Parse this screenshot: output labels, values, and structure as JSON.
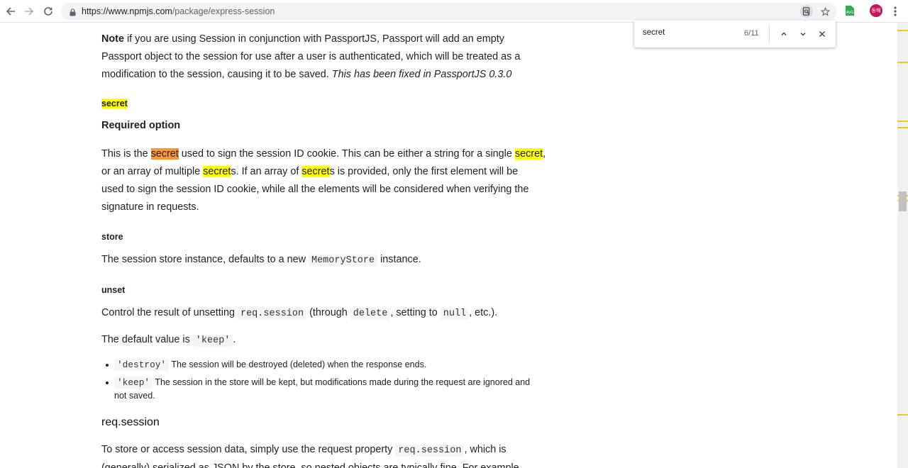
{
  "browser": {
    "url_host": "https://www.npmjs.com",
    "url_path": "/package/express-session",
    "avatar_text": "동해",
    "icons": [
      "back-icon",
      "forward-icon",
      "reload-icon",
      "lock-icon",
      "find-in-page-icon",
      "star-icon",
      "extension-icon",
      "menu-icon"
    ],
    "accent_color": "#1a73e8"
  },
  "find_bar": {
    "query": "secret",
    "count": "6/11"
  },
  "content": {
    "note_bold": "Note",
    "note_text": " if you are using Session in conjunction with PassportJS, Passport will add an empty Passport object to the session for use after a user is authenticated, which will be treated as a modification to the session, causing it to be saved. ",
    "note_italic": "This has been fixed in PassportJS 0.3.0",
    "secret_heading": "secret",
    "required_option": "Required option",
    "secret_p": {
      "t1": "This is the ",
      "m1": "secret",
      "t2": " used to sign the session ID cookie. This can be either a string for a single ",
      "m2": "secret",
      "t3": ",",
      "t4": "or an array of multiple ",
      "m3": "secret",
      "t5": "s. If an array of ",
      "m4": "secret",
      "t6": "s is provided, only the first element will be",
      "t7": "used to sign the session ID cookie, while all the elements will be considered when verifying the",
      "t8": "signature in requests."
    },
    "store_heading": "store",
    "store_p": {
      "t1": "The session store instance, defaults to a new ",
      "code": "MemoryStore",
      "t2": " instance."
    },
    "unset_heading": "unset",
    "unset_p": {
      "t1": "Control the result of unsetting ",
      "c1": "req.session",
      "t2": " (through ",
      "c2": "delete",
      "t3": ", setting to ",
      "c3": "null",
      "t4": ", etc.)."
    },
    "default_p": {
      "t1": "The default value is ",
      "code": "'keep'",
      "t2": "."
    },
    "list": [
      {
        "code": "'destroy'",
        "text": " The session will be destroyed (deleted) when the response ends."
      },
      {
        "code": "'keep'",
        "text": " The session in the store will be kept, but modifications made during the request are ignored and",
        "text2": "not saved."
      }
    ],
    "req_session_heading": "req.session",
    "req_p": {
      "t1": "To store or access session data, simply use the request property ",
      "code": "req.session",
      "t2": ", which is",
      "t3": "(generally) serialized as JSON by the store, so nested objects are typically fine. For example"
    }
  }
}
